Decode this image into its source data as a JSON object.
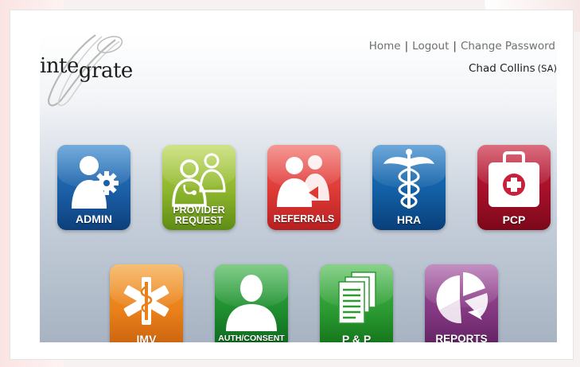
{
  "logo": {
    "text_part1": "inte",
    "text_part2": "grate"
  },
  "nav": {
    "home": "Home",
    "logout": "Logout",
    "change_password": "Change Password",
    "separator": "|"
  },
  "user": {
    "name": "Chad Collins",
    "role": "(SA)"
  },
  "tiles": [
    {
      "label_line1": "ADMIN",
      "label_line2": "",
      "icon": "admin-gear-person-icon",
      "color": "#1b5fa6"
    },
    {
      "label_line1": "PROVIDER",
      "label_line2": "REQUEST",
      "icon": "doctors-icon",
      "color": "#8db52d"
    },
    {
      "label_line1": "REFERRALS",
      "label_line2": "",
      "icon": "people-referral-icon",
      "color": "#dd3a36"
    },
    {
      "label_line1": "HRA",
      "label_line2": "",
      "icon": "caduceus-icon",
      "color": "#135fa5"
    },
    {
      "label_line1": "PCP",
      "label_line2": "",
      "icon": "first-aid-kit-icon",
      "color": "#a5102a"
    },
    {
      "label_line1": "IMV",
      "label_line2": "",
      "icon": "star-of-life-icon",
      "color": "#e9801a"
    },
    {
      "label_line1": "AUTH/CONSENT",
      "label_line2": "",
      "icon": "person-silhouette-icon",
      "color": "#1f8d2f"
    },
    {
      "label_line1": "P & P",
      "label_line2": "",
      "icon": "documents-icon",
      "color": "#2a9a31"
    },
    {
      "label_line1": "REPORTS",
      "label_line2": "",
      "icon": "pie-chart-icon",
      "color": "#843882"
    }
  ]
}
